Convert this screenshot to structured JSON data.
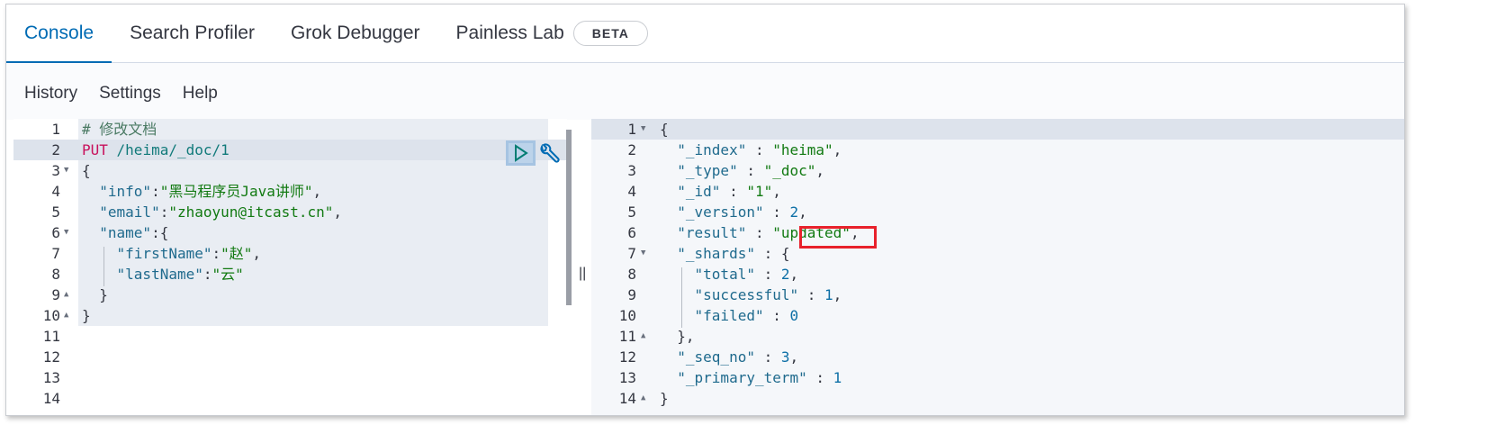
{
  "tabs": [
    {
      "label": "Console",
      "active": true
    },
    {
      "label": "Search Profiler"
    },
    {
      "label": "Grok Debugger"
    },
    {
      "label": "Painless Lab",
      "badge": "BETA"
    }
  ],
  "menu": [
    "History",
    "Settings",
    "Help"
  ],
  "request": {
    "lines": [
      [
        [
          "c",
          "# 修改文档"
        ]
      ],
      [
        [
          "m",
          "PUT"
        ],
        [
          "path",
          " /heima/_doc/1"
        ]
      ],
      [
        [
          "p",
          "{"
        ]
      ],
      [
        [
          "p",
          "  "
        ],
        [
          "k",
          "\"info\""
        ],
        [
          "p",
          ":"
        ],
        [
          "s",
          "\"黑马程序员Java讲师\""
        ],
        [
          "p",
          ","
        ]
      ],
      [
        [
          "p",
          "  "
        ],
        [
          "k",
          "\"email\""
        ],
        [
          "p",
          ":"
        ],
        [
          "s",
          "\"zhaoyun@itcast.cn\""
        ],
        [
          "p",
          ","
        ]
      ],
      [
        [
          "p",
          "  "
        ],
        [
          "k",
          "\"name\""
        ],
        [
          "p",
          ":{"
        ]
      ],
      [
        [
          "p",
          "    "
        ],
        [
          "k",
          "\"firstName\""
        ],
        [
          "p",
          ":"
        ],
        [
          "s",
          "\"赵\""
        ],
        [
          "p",
          ","
        ]
      ],
      [
        [
          "p",
          "    "
        ],
        [
          "k",
          "\"lastName\""
        ],
        [
          "p",
          ":"
        ],
        [
          "s",
          "\"云\""
        ]
      ],
      [
        [
          "p",
          "  }"
        ]
      ],
      [
        [
          "p",
          "}"
        ]
      ],
      [],
      [],
      [],
      []
    ],
    "folds": {
      "3": "down",
      "6": "down",
      "9": "up",
      "10": "up"
    }
  },
  "response": {
    "lines": [
      [
        [
          "p",
          "{"
        ]
      ],
      [
        [
          "p",
          "  "
        ],
        [
          "k",
          "\"_index\""
        ],
        [
          "p",
          " : "
        ],
        [
          "s",
          "\"heima\""
        ],
        [
          "p",
          ","
        ]
      ],
      [
        [
          "p",
          "  "
        ],
        [
          "k",
          "\"_type\""
        ],
        [
          "p",
          " : "
        ],
        [
          "s",
          "\"_doc\""
        ],
        [
          "p",
          ","
        ]
      ],
      [
        [
          "p",
          "  "
        ],
        [
          "k",
          "\"_id\""
        ],
        [
          "p",
          " : "
        ],
        [
          "s",
          "\"1\""
        ],
        [
          "p",
          ","
        ]
      ],
      [
        [
          "p",
          "  "
        ],
        [
          "k",
          "\"_version\""
        ],
        [
          "p",
          " : "
        ],
        [
          "n",
          "2"
        ],
        [
          "p",
          ","
        ]
      ],
      [
        [
          "p",
          "  "
        ],
        [
          "k",
          "\"result\""
        ],
        [
          "p",
          " : "
        ],
        [
          "s",
          "\"updated\""
        ],
        [
          "p",
          ","
        ]
      ],
      [
        [
          "p",
          "  "
        ],
        [
          "k",
          "\"_shards\""
        ],
        [
          "p",
          " : {"
        ]
      ],
      [
        [
          "p",
          "    "
        ],
        [
          "k",
          "\"total\""
        ],
        [
          "p",
          " : "
        ],
        [
          "n",
          "2"
        ],
        [
          "p",
          ","
        ]
      ],
      [
        [
          "p",
          "    "
        ],
        [
          "k",
          "\"successful\""
        ],
        [
          "p",
          " : "
        ],
        [
          "n",
          "1"
        ],
        [
          "p",
          ","
        ]
      ],
      [
        [
          "p",
          "    "
        ],
        [
          "k",
          "\"failed\""
        ],
        [
          "p",
          " : "
        ],
        [
          "n",
          "0"
        ]
      ],
      [
        [
          "p",
          "  },"
        ]
      ],
      [
        [
          "p",
          "  "
        ],
        [
          "k",
          "\"_seq_no\""
        ],
        [
          "p",
          " : "
        ],
        [
          "n",
          "3"
        ],
        [
          "p",
          ","
        ]
      ],
      [
        [
          "p",
          "  "
        ],
        [
          "k",
          "\"_primary_term\""
        ],
        [
          "p",
          " : "
        ],
        [
          "n",
          "1"
        ]
      ],
      [
        [
          "p",
          "}"
        ]
      ]
    ],
    "folds": {
      "1": "down",
      "7": "down",
      "11": "up",
      "14": "up"
    }
  },
  "colors": {
    "accent": "#006bb4",
    "highlight_box": "#e8212b"
  }
}
